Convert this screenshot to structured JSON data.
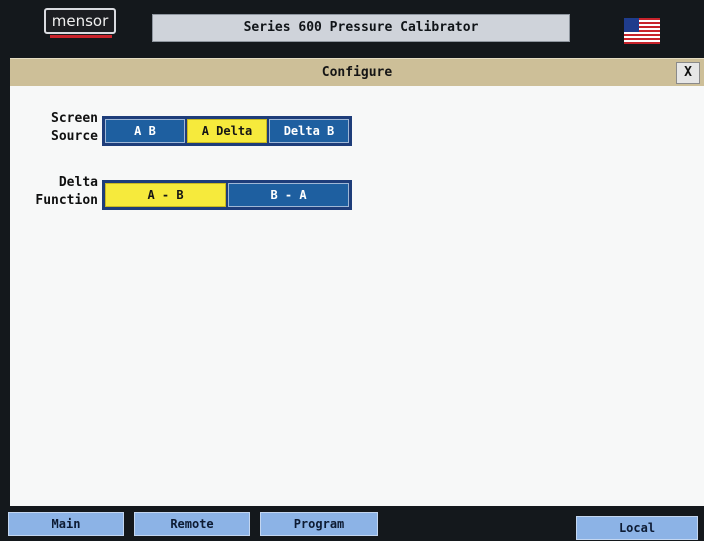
{
  "header": {
    "logo_text": "mensor",
    "title": "Series 600 Pressure Calibrator",
    "flag_icon": "us-flag-icon"
  },
  "dialog": {
    "title": "Configure",
    "close_label": "X"
  },
  "screen_source": {
    "label_line1": "Screen",
    "label_line2": "Source",
    "options": [
      "A B",
      "A Delta",
      "Delta B"
    ],
    "selected": "A Delta"
  },
  "delta_function": {
    "label_line1": "Delta",
    "label_line2": "Function",
    "options": [
      "A - B",
      "B - A"
    ],
    "selected": "A - B"
  },
  "footer": {
    "tabs": [
      "Main",
      "Remote",
      "Program"
    ],
    "local_label": "Local"
  },
  "colors": {
    "accent_blue": "#1e5fa0",
    "active_yellow": "#f6ea3c",
    "header_tan": "#cdbf98",
    "tab_blue": "#8cb3e6",
    "logo_red": "#c8232b"
  }
}
